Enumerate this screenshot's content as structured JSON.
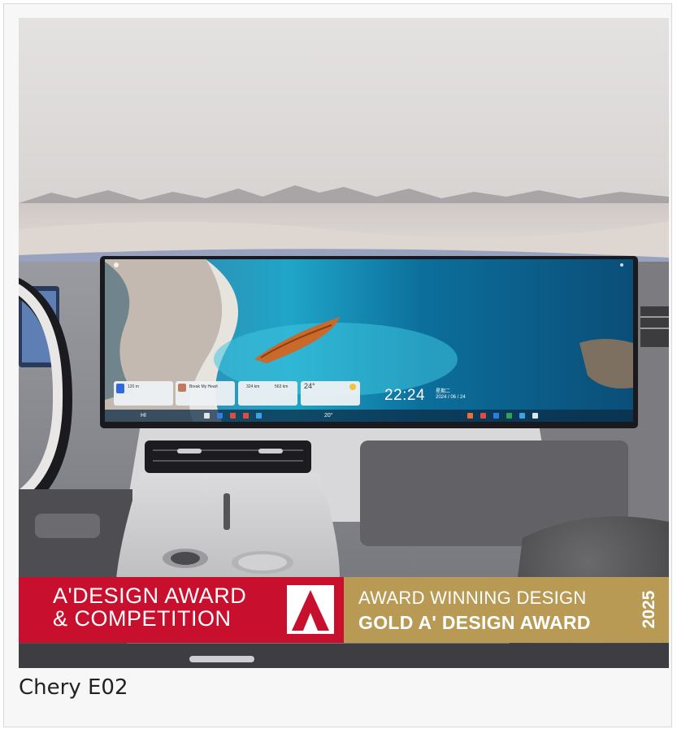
{
  "caption": "Chery E02",
  "banner": {
    "line1": "A'DESIGN AWARD",
    "line2": "& COMPETITION",
    "gold_line1": "AWARD WINNING DESIGN",
    "gold_line2": "GOLD A' DESIGN AWARD",
    "year": "2025"
  },
  "screen": {
    "clock": "22:24",
    "weekday": "星期二",
    "date": "2024 / 06 / 24",
    "widgets": {
      "nav_distance": "120 m",
      "music_title": "Break My Heart",
      "range_left": "324 km",
      "range_right": "563 km",
      "temperature": "24°"
    },
    "bottom_bar": {
      "fan_level": "HI",
      "cabin_temp": "20°"
    }
  },
  "colors": {
    "award_red": "#c8102e",
    "award_gold": "#b99a55",
    "lake": "#1b8fb5",
    "boat": "#c9692a"
  }
}
